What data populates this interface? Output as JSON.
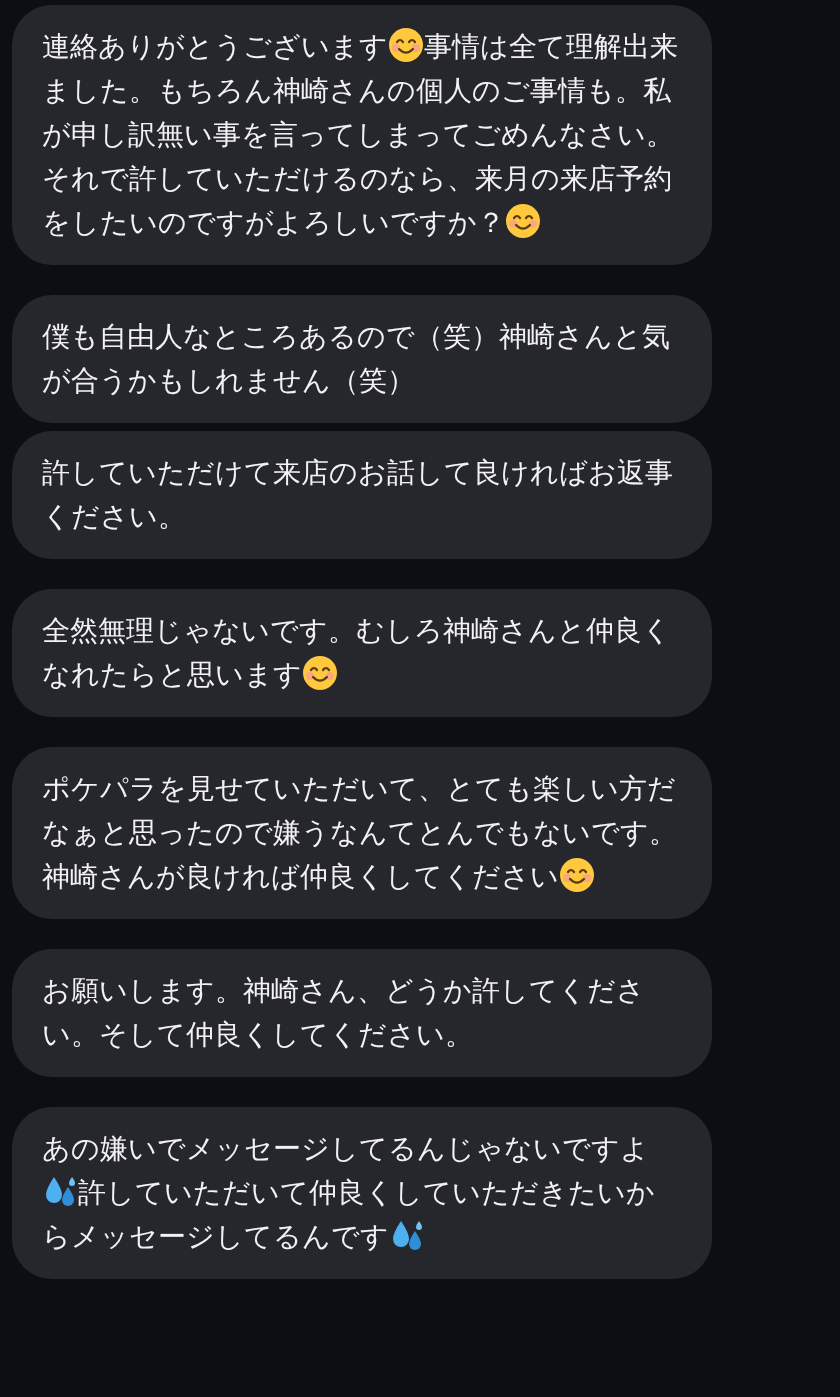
{
  "groups": [
    {
      "messages": [
        {
          "segments": [
            {
              "kind": "text",
              "text": "連絡ありがとうございます"
            },
            {
              "kind": "smile"
            },
            {
              "kind": "text",
              "text": "事情は全て理解出来ました。もちろん神崎さんの個人のご事情も。私が申し訳無い事を言ってしまってごめんなさい。それで許していただけるのなら、来月の来店予約をしたいのですがよろしいですか？"
            },
            {
              "kind": "smile"
            }
          ]
        }
      ]
    },
    {
      "messages": [
        {
          "segments": [
            {
              "kind": "text",
              "text": "僕も自由人なところあるので（笑）神崎さんと気が合うかもしれません（笑）"
            }
          ]
        },
        {
          "segments": [
            {
              "kind": "text",
              "text": "許していただけて来店のお話して良ければお返事ください。"
            }
          ]
        }
      ]
    },
    {
      "messages": [
        {
          "segments": [
            {
              "kind": "text",
              "text": "全然無理じゃないです。むしろ神崎さんと仲良くなれたらと思います"
            },
            {
              "kind": "smile"
            }
          ]
        }
      ]
    },
    {
      "messages": [
        {
          "segments": [
            {
              "kind": "text",
              "text": "ポケパラを見せていただいて、とても楽しい方だなぁと思ったので嫌うなんてとんでもないです。神崎さんが良ければ仲良くしてください"
            },
            {
              "kind": "smile"
            }
          ]
        }
      ]
    },
    {
      "messages": [
        {
          "segments": [
            {
              "kind": "text",
              "text": "お願いします。神崎さん、どうか許してください。そして仲良くしてください。"
            }
          ]
        }
      ]
    },
    {
      "messages": [
        {
          "segments": [
            {
              "kind": "text",
              "text": "あの嫌いでメッセージしてるんじゃないですよ"
            },
            {
              "kind": "drops"
            },
            {
              "kind": "text",
              "text": "許していただいて仲良くしていただきたいからメッセージしてるんです"
            },
            {
              "kind": "drops"
            }
          ]
        }
      ]
    }
  ]
}
